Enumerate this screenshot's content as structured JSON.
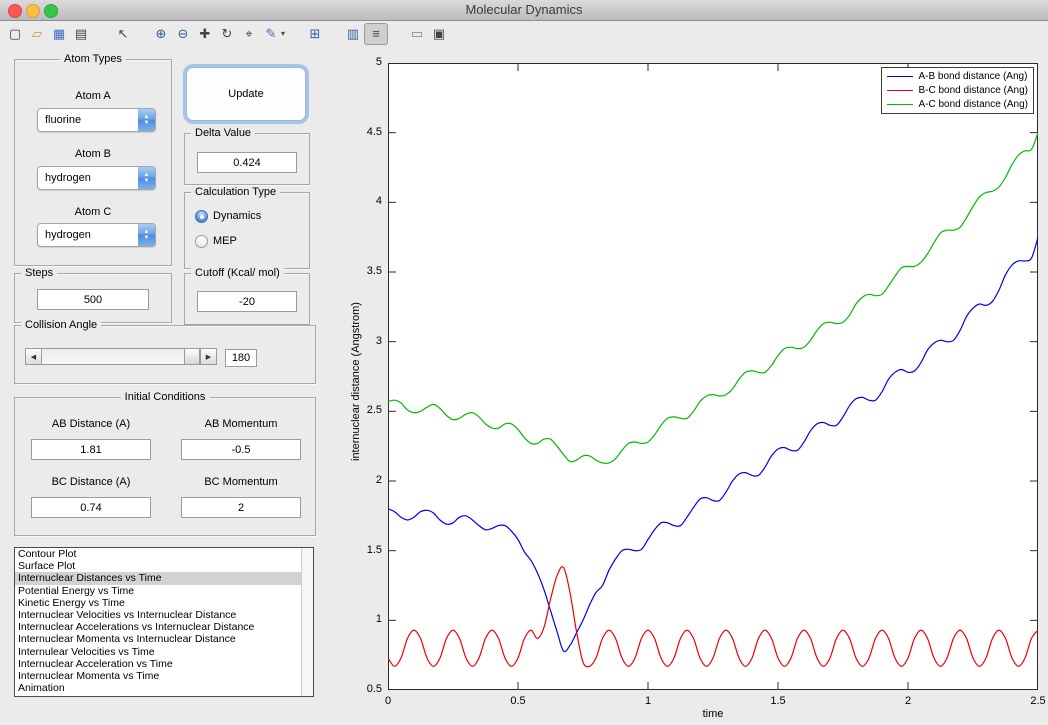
{
  "window": {
    "title": "Molecular Dynamics",
    "controls": [
      "close",
      "minimize",
      "zoom"
    ]
  },
  "toolbar": {
    "icons": [
      {
        "name": "new-figure-icon",
        "glyph": "▢"
      },
      {
        "name": "open-file-icon",
        "glyph": "▱"
      },
      {
        "name": "save-figure-icon",
        "glyph": "▦"
      },
      {
        "name": "print-figure-icon",
        "glyph": "▤"
      },
      {
        "name": "edit-pointer-icon",
        "glyph": "↖"
      },
      {
        "name": "zoom-in-icon",
        "glyph": "⊕"
      },
      {
        "name": "zoom-out-icon",
        "glyph": "⊖"
      },
      {
        "name": "pan-hand-icon",
        "glyph": "✚"
      },
      {
        "name": "rotate-3d-icon",
        "glyph": "↻"
      },
      {
        "name": "data-cursor-icon",
        "glyph": "⌖"
      },
      {
        "name": "brush-data-icon",
        "glyph": "✎"
      },
      {
        "name": "brush-dropdown-icon",
        "glyph": "▾"
      },
      {
        "name": "link-plot-icon",
        "glyph": "⊞"
      },
      {
        "name": "insert-colorbar-icon",
        "glyph": "▥"
      },
      {
        "name": "insert-legend-icon",
        "glyph": "≡"
      },
      {
        "name": "hide-plot-tools-icon",
        "glyph": "▭"
      },
      {
        "name": "show-plot-tools-icon",
        "glyph": "▣"
      }
    ]
  },
  "panels": {
    "update_label": "Update",
    "atom_types": {
      "title": "Atom Types",
      "fields": [
        {
          "label": "Atom A",
          "value": "fluorine"
        },
        {
          "label": "Atom B",
          "value": "hydrogen"
        },
        {
          "label": "Atom C",
          "value": "hydrogen"
        }
      ]
    },
    "delta": {
      "title": "Delta Value",
      "value": "0.424"
    },
    "calculation_type": {
      "title": "Calculation Type",
      "options": [
        {
          "label": "Dynamics",
          "selected": true
        },
        {
          "label": "MEP",
          "selected": false
        }
      ]
    },
    "steps": {
      "title": "Steps",
      "value": "500"
    },
    "cutoff": {
      "title": "Cutoff (Kcal/ mol)",
      "value": "-20"
    },
    "collision_angle": {
      "title": "Collision Angle",
      "value": "180",
      "slider_position": "max"
    },
    "initial_conditions": {
      "title": "Initial Conditions",
      "fields": [
        {
          "label": "AB Distance (A)",
          "value": "1.81"
        },
        {
          "label": "AB Momentum",
          "value": "-0.5"
        },
        {
          "label": "BC Distance (A)",
          "value": "0.74"
        },
        {
          "label": "BC Momentum",
          "value": "2"
        }
      ]
    },
    "plot_list": {
      "selected_index": 2,
      "items": [
        "Contour Plot",
        "Surface Plot",
        "Internuclear Distances vs Time",
        "Potential Energy vs Time",
        "Kinetic Energy vs Time",
        "Internuclear Velocities vs Internuclear Distance",
        "Internuclear Accelerations vs Internuclear Distance",
        "Internuclear Momenta vs Internuclear Distance",
        "Internulear Velocities vs Time",
        "Internuclear Acceleration vs Time",
        "Internuclear Momenta vs Time",
        "Animation"
      ]
    }
  },
  "chart_data": {
    "type": "line",
    "title": "",
    "xlabel": "time",
    "ylabel": "internuclear distance (Angstrom)",
    "xlim": [
      0,
      2.5
    ],
    "ylim": [
      0.5,
      5
    ],
    "xticks": [
      0,
      0.5,
      1,
      1.5,
      2,
      2.5
    ],
    "yticks": [
      0.5,
      1,
      1.5,
      2,
      2.5,
      3,
      3.5,
      4,
      4.5,
      5
    ],
    "grid": false,
    "legend_position": "top-right",
    "x": [
      0,
      0.025,
      0.05,
      0.075,
      0.1,
      0.125,
      0.15,
      0.175,
      0.2,
      0.225,
      0.25,
      0.275,
      0.3,
      0.325,
      0.35,
      0.375,
      0.4,
      0.425,
      0.45,
      0.475,
      0.5,
      0.525,
      0.55,
      0.575,
      0.6,
      0.625,
      0.65,
      0.675,
      0.7,
      0.725,
      0.75,
      0.775,
      0.8,
      0.825,
      0.85,
      0.875,
      0.9,
      0.925,
      0.95,
      0.975,
      1,
      1.025,
      1.05,
      1.075,
      1.1,
      1.125,
      1.15,
      1.175,
      1.2,
      1.225,
      1.25,
      1.275,
      1.3,
      1.325,
      1.35,
      1.375,
      1.4,
      1.425,
      1.45,
      1.475,
      1.5,
      1.525,
      1.55,
      1.575,
      1.6,
      1.625,
      1.65,
      1.675,
      1.7,
      1.725,
      1.75,
      1.775,
      1.8,
      1.825,
      1.85,
      1.875,
      1.9,
      1.925,
      1.95,
      1.975,
      2,
      2.025,
      2.05,
      2.075,
      2.1,
      2.125,
      2.15,
      2.175,
      2.2,
      2.225,
      2.25,
      2.275,
      2.3,
      2.325,
      2.35,
      2.375,
      2.4,
      2.425,
      2.45,
      2.475,
      2.5
    ],
    "series": [
      {
        "name": "A-B bond distance (Ang)",
        "color": "#0000ee",
        "values": [
          1.8,
          1.78,
          1.74,
          1.72,
          1.74,
          1.78,
          1.79,
          1.77,
          1.72,
          1.69,
          1.7,
          1.74,
          1.75,
          1.72,
          1.68,
          1.65,
          1.66,
          1.68,
          1.68,
          1.64,
          1.58,
          1.49,
          1.43,
          1.34,
          1.22,
          1.07,
          0.92,
          0.78,
          0.82,
          0.91,
          1.0,
          1.11,
          1.2,
          1.25,
          1.36,
          1.44,
          1.5,
          1.51,
          1.5,
          1.51,
          1.58,
          1.65,
          1.7,
          1.7,
          1.68,
          1.68,
          1.74,
          1.81,
          1.87,
          1.88,
          1.86,
          1.86,
          1.92,
          2.0,
          2.05,
          2.06,
          2.04,
          2.04,
          2.1,
          2.18,
          2.23,
          2.24,
          2.22,
          2.22,
          2.28,
          2.36,
          2.41,
          2.42,
          2.4,
          2.4,
          2.46,
          2.54,
          2.59,
          2.6,
          2.58,
          2.58,
          2.64,
          2.73,
          2.78,
          2.8,
          2.78,
          2.79,
          2.85,
          2.94,
          2.99,
          3.01,
          3.0,
          3.01,
          3.08,
          3.18,
          3.24,
          3.27,
          3.26,
          3.29,
          3.37,
          3.48,
          3.55,
          3.58,
          3.58,
          3.6,
          3.75
        ]
      },
      {
        "name": "B-C bond distance (Ang)",
        "color": "#ee0000",
        "values": [
          0.73,
          0.67,
          0.73,
          0.87,
          0.93,
          0.87,
          0.73,
          0.67,
          0.73,
          0.87,
          0.93,
          0.87,
          0.73,
          0.67,
          0.73,
          0.87,
          0.93,
          0.87,
          0.73,
          0.67,
          0.73,
          0.87,
          0.93,
          0.87,
          0.95,
          1.15,
          1.32,
          1.38,
          1.2,
          0.92,
          0.7,
          0.67,
          0.73,
          0.87,
          0.93,
          0.87,
          0.73,
          0.67,
          0.73,
          0.87,
          0.93,
          0.87,
          0.73,
          0.67,
          0.73,
          0.87,
          0.93,
          0.87,
          0.73,
          0.67,
          0.73,
          0.87,
          0.93,
          0.87,
          0.73,
          0.67,
          0.73,
          0.87,
          0.93,
          0.87,
          0.73,
          0.67,
          0.73,
          0.87,
          0.93,
          0.87,
          0.73,
          0.67,
          0.73,
          0.87,
          0.93,
          0.87,
          0.73,
          0.67,
          0.73,
          0.87,
          0.93,
          0.87,
          0.73,
          0.67,
          0.73,
          0.87,
          0.93,
          0.87,
          0.73,
          0.67,
          0.73,
          0.87,
          0.93,
          0.87,
          0.73,
          0.67,
          0.73,
          0.87,
          0.93,
          0.87,
          0.73,
          0.67,
          0.73,
          0.87,
          0.93
        ]
      },
      {
        "name": "A-C bond distance (Ang)",
        "color": "#00bb00",
        "values": [
          2.57,
          2.58,
          2.56,
          2.51,
          2.49,
          2.5,
          2.53,
          2.55,
          2.52,
          2.47,
          2.44,
          2.45,
          2.48,
          2.49,
          2.46,
          2.41,
          2.38,
          2.38,
          2.41,
          2.41,
          2.37,
          2.31,
          2.27,
          2.27,
          2.3,
          2.3,
          2.25,
          2.19,
          2.14,
          2.15,
          2.18,
          2.18,
          2.15,
          2.13,
          2.13,
          2.16,
          2.22,
          2.27,
          2.28,
          2.27,
          2.28,
          2.33,
          2.4,
          2.45,
          2.46,
          2.45,
          2.45,
          2.5,
          2.57,
          2.61,
          2.62,
          2.61,
          2.62,
          2.66,
          2.73,
          2.78,
          2.79,
          2.78,
          2.78,
          2.83,
          2.9,
          2.95,
          2.96,
          2.95,
          2.96,
          3.01,
          3.08,
          3.13,
          3.14,
          3.13,
          3.14,
          3.19,
          3.27,
          3.32,
          3.34,
          3.33,
          3.34,
          3.4,
          3.47,
          3.53,
          3.54,
          3.54,
          3.57,
          3.63,
          3.71,
          3.78,
          3.8,
          3.8,
          3.82,
          3.89,
          3.97,
          4.04,
          4.07,
          4.08,
          4.11,
          4.18,
          4.27,
          4.34,
          4.37,
          4.38,
          4.5
        ]
      }
    ]
  }
}
